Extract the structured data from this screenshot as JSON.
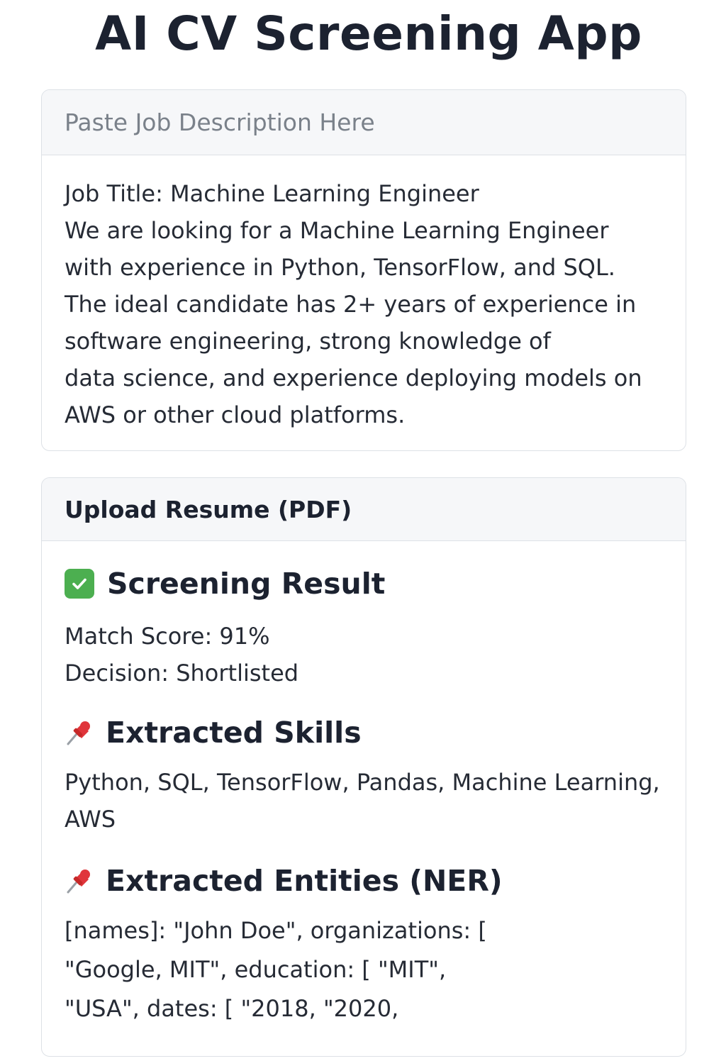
{
  "app": {
    "title": "AI CV Screening App"
  },
  "job_description": {
    "placeholder": "Paste Job Description Here",
    "text": "Job Title: Machine Learning Engineer\nWe are looking for a Machine Learning Engineer with experience in Python, TensorFlow, and SQL. The ideal candidate has 2+ years of experience in software engineering, strong knowledge of\ndata science, and experience deploying models on AWS or other cloud platforms."
  },
  "upload": {
    "label": "Upload Resume (PDF)"
  },
  "result": {
    "heading": "Screening Result",
    "heading_icon": "check-mark-icon",
    "match_score": "Match Score: 91%",
    "decision": "Decision: Shortlisted",
    "skills_heading": "Extracted Skills",
    "skills_icon": "pushpin-icon",
    "skills": "Python, SQL, TensorFlow, Pandas, Machine Learning, AWS",
    "entities_heading": "Extracted Entities (NER)",
    "entities_icon": "pushpin-icon",
    "entities": "[names]: \"John Doe\", organizations: [ \"Google, MIT\", education: [ \"MIT\", \"USA\", dates: [ \"2018, \"2020,"
  },
  "colors": {
    "accent_green": "#4caf50",
    "pin_red": "#e0353b",
    "header_bg": "#f6f7f9",
    "border": "#dde1e6"
  }
}
